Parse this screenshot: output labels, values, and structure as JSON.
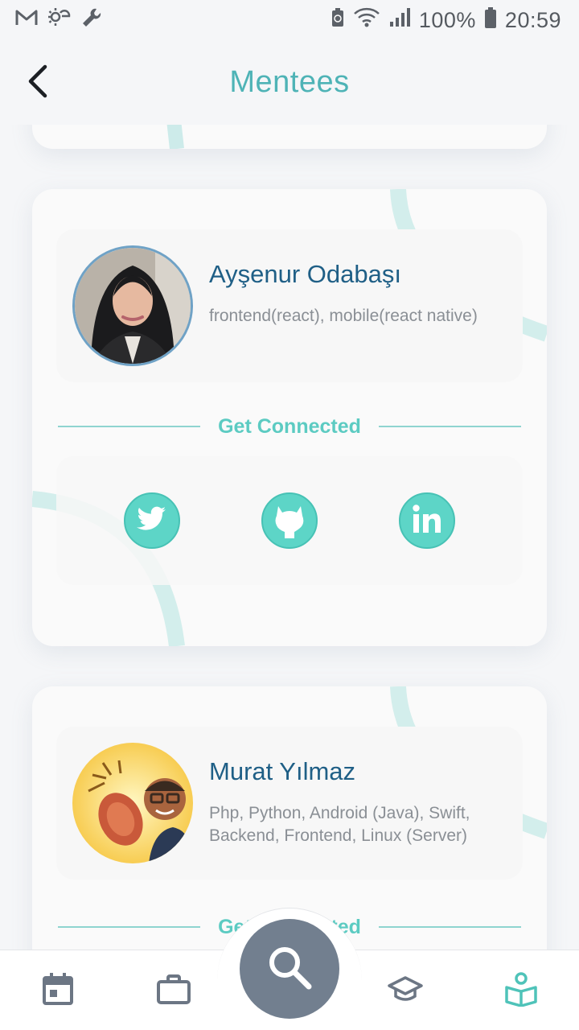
{
  "status_bar": {
    "battery_percent": "100%",
    "time": "20:59",
    "left_icons": [
      "gmail-icon",
      "weather-icon",
      "wrench-icon"
    ],
    "right_icons": [
      "recycle-battery-icon",
      "wifi-icon",
      "signal-icon",
      "battery-icon"
    ]
  },
  "header": {
    "title": "Mentees",
    "back_icon": "chevron-left-icon"
  },
  "colors": {
    "accent": "#4eb3b6",
    "social": "#5dd5c7",
    "name": "#1f5f86",
    "fab": "#727f8f"
  },
  "mentees": [
    {
      "name": "Ayşenur Odabaşı",
      "skills": "frontend(react), mobile(react native)",
      "connect_label": "Get Connected",
      "socials": [
        "twitter-icon",
        "github-icon",
        "linkedin-icon"
      ]
    },
    {
      "name": "Murat Yılmaz",
      "skills": "Php, Python, Android (Java), Swift, Backend, Frontend, Linux (Server)",
      "connect_label": "Get Connected"
    }
  ],
  "bottom_nav": {
    "items": [
      "calendar-icon",
      "briefcase-icon",
      "search-icon",
      "graduation-cap-icon",
      "reading-person-icon"
    ],
    "active": "reading-person-icon"
  }
}
